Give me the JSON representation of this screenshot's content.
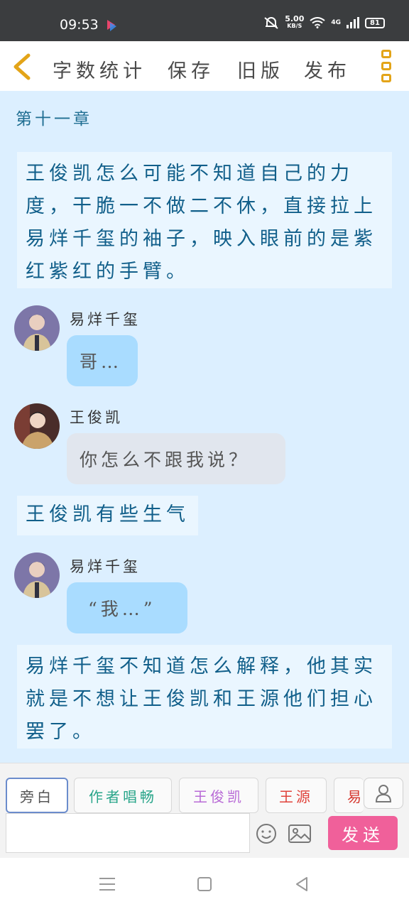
{
  "status": {
    "time": "09:53",
    "net_speed_value": "5.00",
    "net_speed_unit": "KB/S",
    "network": "4G",
    "battery": "81"
  },
  "toolbar": {
    "word_count": "字数统计",
    "save": "保存",
    "old_version": "旧版",
    "publish": "发布"
  },
  "story": {
    "chapter_title": "第十一章",
    "narration_1": "王俊凯怎么可能不知道自己的力度，干脆一不做二不休，直接拉上易烊千玺的袖子，映入眼前的是紫红紫红的手臂。",
    "msg_1_name": "易烊千玺",
    "msg_1_text": "哥…",
    "msg_2_name": "王俊凯",
    "msg_2_text": "你怎么不跟我说？",
    "narration_2": "王俊凯有些生气",
    "msg_3_name": "易烊千玺",
    "msg_3_text": "“我…”",
    "narration_3": "易烊千玺不知道怎么解释，他其实就是不想让王俊凯和王源他们担心罢了。"
  },
  "roles": {
    "narrator": "旁白",
    "author": "作者唱畅",
    "role_1": "王俊凯",
    "role_2": "王源",
    "role_3": "易",
    "author_color": "#29a58a",
    "role_1_color": "#b86ad6",
    "role_2_color": "#e0423a",
    "role_3_color": "#d6382f"
  },
  "composer": {
    "input_value": "",
    "send_label": "发送",
    "send_color": "#f0609a"
  }
}
